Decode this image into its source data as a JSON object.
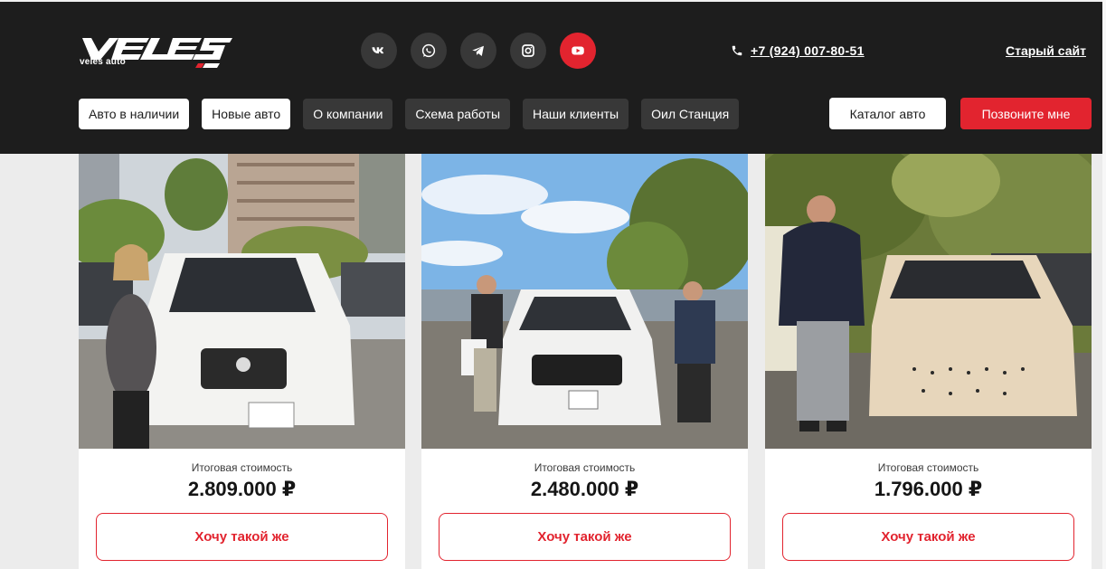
{
  "brand": {
    "logo_text": "VELES",
    "subtitle": "veles auto"
  },
  "socials": [
    {
      "name": "vk-icon"
    },
    {
      "name": "whatsapp-icon"
    },
    {
      "name": "telegram-icon"
    },
    {
      "name": "instagram-icon"
    },
    {
      "name": "youtube-icon"
    }
  ],
  "contact": {
    "phone": "+7 (924) 007-80-51",
    "old_site": "Старый сайт"
  },
  "nav": [
    {
      "label": "Авто в наличии"
    },
    {
      "label": "Новые авто"
    },
    {
      "label": "О компании"
    },
    {
      "label": "Схема работы"
    },
    {
      "label": "Наши клиенты"
    },
    {
      "label": "Оил Станция"
    }
  ],
  "actions": {
    "catalog": "Каталог авто",
    "call": "Позвоните мне"
  },
  "cards": [
    {
      "price_label": "Итоговая стоимость",
      "price": "2.809.000 ₽",
      "button": "Хочу такой же"
    },
    {
      "price_label": "Итоговая стоимость",
      "price": "2.480.000 ₽",
      "button": "Хочу такой же"
    },
    {
      "price_label": "Итоговая стоимость",
      "price": "1.796.000 ₽",
      "button": "Хочу такой же"
    }
  ],
  "colors": {
    "header": "#1d1d1d",
    "accent": "#e2242f",
    "pill": "#383838"
  }
}
